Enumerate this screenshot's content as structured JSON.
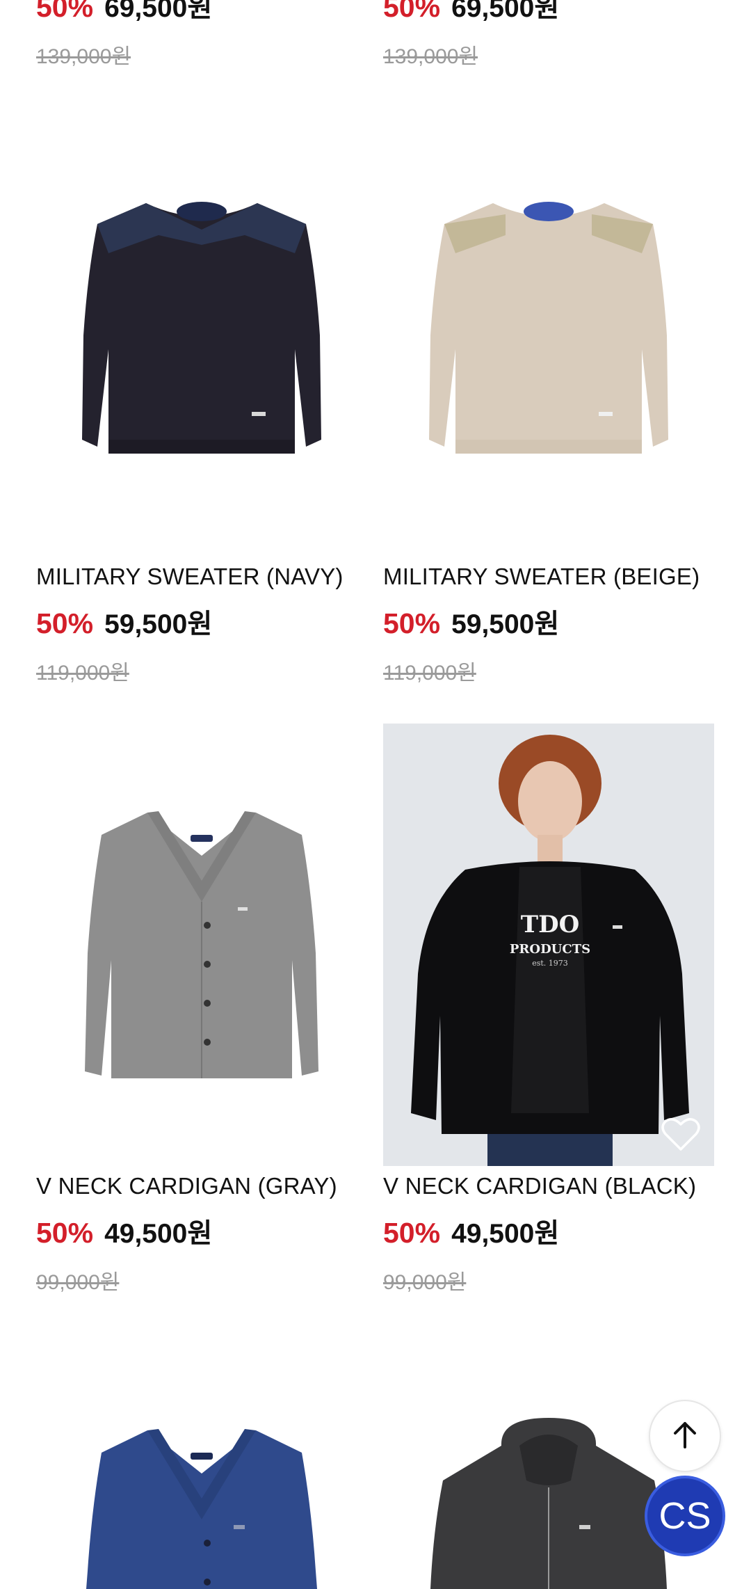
{
  "products_top": [
    {
      "discount": "50%",
      "sale_price": "69,500원",
      "original_price": "139,000원"
    },
    {
      "discount": "50%",
      "sale_price": "69,500원",
      "original_price": "139,000원"
    }
  ],
  "products": [
    {
      "name": "MILITARY SWEATER (NAVY)",
      "discount": "50%",
      "sale_price": "59,500원",
      "original_price": "119,000원",
      "image": "navy-sweater"
    },
    {
      "name": "MILITARY SWEATER (BEIGE)",
      "discount": "50%",
      "sale_price": "59,500원",
      "original_price": "119,000원",
      "image": "beige-sweater"
    },
    {
      "name": "V NECK CARDIGAN (GRAY)",
      "discount": "50%",
      "sale_price": "49,500원",
      "original_price": "99,000원",
      "image": "gray-cardigan"
    },
    {
      "name": "V NECK CARDIGAN (BLACK)",
      "discount": "50%",
      "sale_price": "49,500원",
      "original_price": "99,000원",
      "image": "model-black-cardigan"
    }
  ],
  "products_bottom": [
    {
      "image": "blue-cardigan"
    },
    {
      "image": "charcoal-hoodie"
    }
  ],
  "floating": {
    "scroll_top_icon": "arrow-up-icon",
    "cs_label": "CS"
  },
  "colors": {
    "discount": "#d31f2a",
    "cs_button": "#1f3bb3"
  }
}
